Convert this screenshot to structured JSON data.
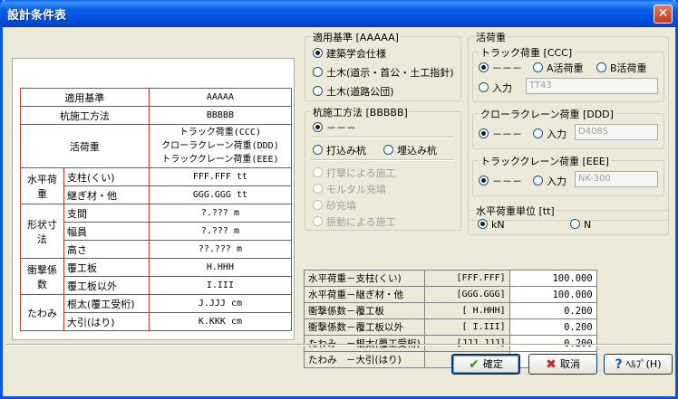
{
  "window": {
    "title": "設計条件表",
    "close_label": "✕"
  },
  "spec_table": {
    "rows": [
      {
        "label": "適用基準",
        "value": "AAAAA"
      },
      {
        "label": "杭施工方法",
        "value": "BBBBB"
      },
      {
        "label": "活荷重",
        "values": [
          "トラック荷重(CCC)",
          "クローラクレーン荷重(DDD)",
          "トラッククレーン荷重(EEE)"
        ]
      }
    ],
    "groups": [
      {
        "label": "水平荷重",
        "items": [
          {
            "sub": "支柱(くい)",
            "value": "FFF.FFF  tt"
          },
          {
            "sub": "継ぎ材・他",
            "value": "GGG.GGG  tt"
          }
        ]
      },
      {
        "label": "形状寸法",
        "items": [
          {
            "sub": "支間",
            "value": "?.??? m"
          },
          {
            "sub": "幅員",
            "value": "?.??? m"
          },
          {
            "sub": "高さ",
            "value": "??.??? m"
          }
        ]
      },
      {
        "label": "衝撃係数",
        "items": [
          {
            "sub": "覆工板",
            "value": "H.HHH"
          },
          {
            "sub": "覆工板以外",
            "value": "I.III"
          }
        ]
      },
      {
        "label": "たわみ",
        "items": [
          {
            "sub": "根太(覆工受桁)",
            "value": "J.JJJ  cm"
          },
          {
            "sub": "大引(はり)",
            "value": "K.KKK  cm"
          }
        ]
      }
    ]
  },
  "standard_group": {
    "label": "適用基準 [AAAAA]",
    "options": [
      "建築学会仕様",
      "土木(道示・首公・土工指針)",
      "土木(道路公団)"
    ]
  },
  "pile_group": {
    "label": "杭施工方法 [BBBBB]",
    "top_option": "－－－",
    "opt_driven": "打込み杭",
    "opt_buried": "埋込み杭",
    "disabled_options": [
      "打撃による施工",
      "モルタル充填",
      "砂充填",
      "振動による施工"
    ]
  },
  "live_load": {
    "label": "活荷重",
    "truck": {
      "label": "トラック荷重 [CCC]",
      "opt_none": "－－－",
      "opt_a": "A活荷重",
      "opt_b": "B活荷重",
      "opt_input": "入力",
      "input_value": "TT43"
    },
    "crawler": {
      "label": "クローラクレーン荷重 [DDD]",
      "opt_none": "－－－",
      "opt_input": "入力",
      "input_value": "D408S"
    },
    "truck_crane": {
      "label": "トラッククレーン荷重 [EEE]",
      "opt_none": "－－－",
      "opt_input": "入力",
      "input_value": "NK-300"
    }
  },
  "unit_group": {
    "label": "水平荷重単位 [tt]",
    "opt_kn": "kN",
    "opt_n": "N"
  },
  "results": [
    {
      "label": "水平荷重－支柱(くい)",
      "code": "[FFF.FFF]",
      "value": "100.000"
    },
    {
      "label": "水平荷重－継ぎ材・他",
      "code": "[GGG.GGG]",
      "value": "100.000"
    },
    {
      "label": "衝撃係数－覆工板",
      "code": "[  H.HHH]",
      "value": "0.200"
    },
    {
      "label": "衝撃係数－覆工板以外",
      "code": "[  I.III]",
      "value": "0.200"
    },
    {
      "label": "たわみ　－根太(覆工受桁)",
      "code": "[JJJ.JJJ]",
      "value": "0.200"
    },
    {
      "label": "たわみ　－大引(はり)",
      "code": "[KKK.KKK]",
      "value": "0.200"
    }
  ],
  "buttons": {
    "ok": "確定",
    "cancel": "取消",
    "help": "ﾍﾙﾌﾟ(H)"
  }
}
